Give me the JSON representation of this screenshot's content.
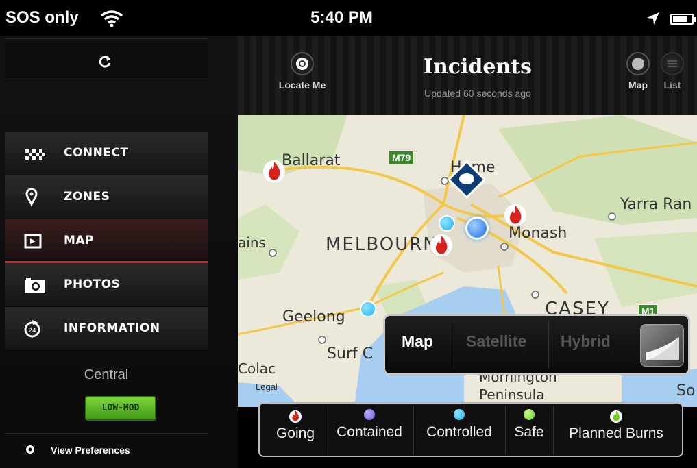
{
  "status_bar": {
    "carrier": "SOS only",
    "time": "5:40 PM"
  },
  "sidebar": {
    "items": [
      {
        "label": "CONNECT",
        "icon": "checker-icon"
      },
      {
        "label": "ZONES",
        "icon": "pin-icon"
      },
      {
        "label": "MAP",
        "icon": "map-frame-icon"
      },
      {
        "label": "PHOTOS",
        "icon": "camera-icon"
      },
      {
        "label": "INFORMATION",
        "icon": "clock-24-icon"
      }
    ],
    "active_index": 2,
    "zone": "Central",
    "zone_badge": "LOW-MOD",
    "preferences": "View Preferences"
  },
  "header": {
    "title": "Incidents",
    "subtitle": "Updated 60 seconds ago",
    "locate_label": "Locate Me",
    "map_label": "Map",
    "list_label": "List"
  },
  "map": {
    "labels": {
      "ballarat": "Ballarat",
      "melbourne": "MELBOURNE",
      "monash": "Monash",
      "yarra": "Yarra Ran",
      "hume": "Hume",
      "geelong": "Geelong",
      "surf": "Surf C",
      "colac": "Colac",
      "casey": "CASEY",
      "mornington": "Mornington",
      "peninsula": "Peninsula",
      "so": "So",
      "ains": "ains",
      "m79": "M79",
      "m1": "M1",
      "legal": "Legal"
    },
    "type_options": [
      "Map",
      "Satellite",
      "Hybrid"
    ],
    "selected_type": "Map"
  },
  "legend": [
    {
      "label": "Going",
      "color": "#d8221c"
    },
    {
      "label": "Contained",
      "color": "#6a5fd6"
    },
    {
      "label": "Controlled",
      "color": "#1fb3ea"
    },
    {
      "label": "Safe",
      "color": "#6fcf1b"
    },
    {
      "label": "Planned Burns",
      "color": "#6fcf1b"
    }
  ],
  "colors": {
    "accent": "#c8201e",
    "badge": "#5fb82a"
  }
}
